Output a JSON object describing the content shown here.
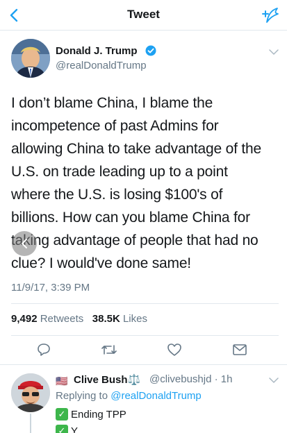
{
  "header": {
    "title": "Tweet",
    "accent": "#1da1f2"
  },
  "author": {
    "name": "Donald J. Trump",
    "handle": "@realDonaldTrump",
    "verified": true
  },
  "tweet": {
    "lines": [
      "I don’t blame China, I blame the",
      "incompetence of past Admins for",
      "allowing China to take advantage of the",
      "U.S. on trade leading up to a point",
      "where the U.S. is losing $100's of",
      "billions. How can you blame China for",
      "taking advantage of people that had no",
      "clue? I would've done same!"
    ],
    "timestamp": "11/9/17, 3:39 PM"
  },
  "stats": {
    "retweets_count": "9,492",
    "retweets_label": "Retweets",
    "likes_count": "38.5K",
    "likes_label": "Likes"
  },
  "actions": [
    "reply-icon",
    "retweet-icon",
    "like-icon",
    "share-icon"
  ],
  "reply": {
    "flag": "🇺🇸",
    "name": "Clive Bush⚖️",
    "handle": "@clivebushjd · 1h",
    "replying_prefix": "Replying to",
    "replying_to": "@realDonaldTrump",
    "lines": [
      "Ending TPP",
      "Y..."
    ]
  }
}
